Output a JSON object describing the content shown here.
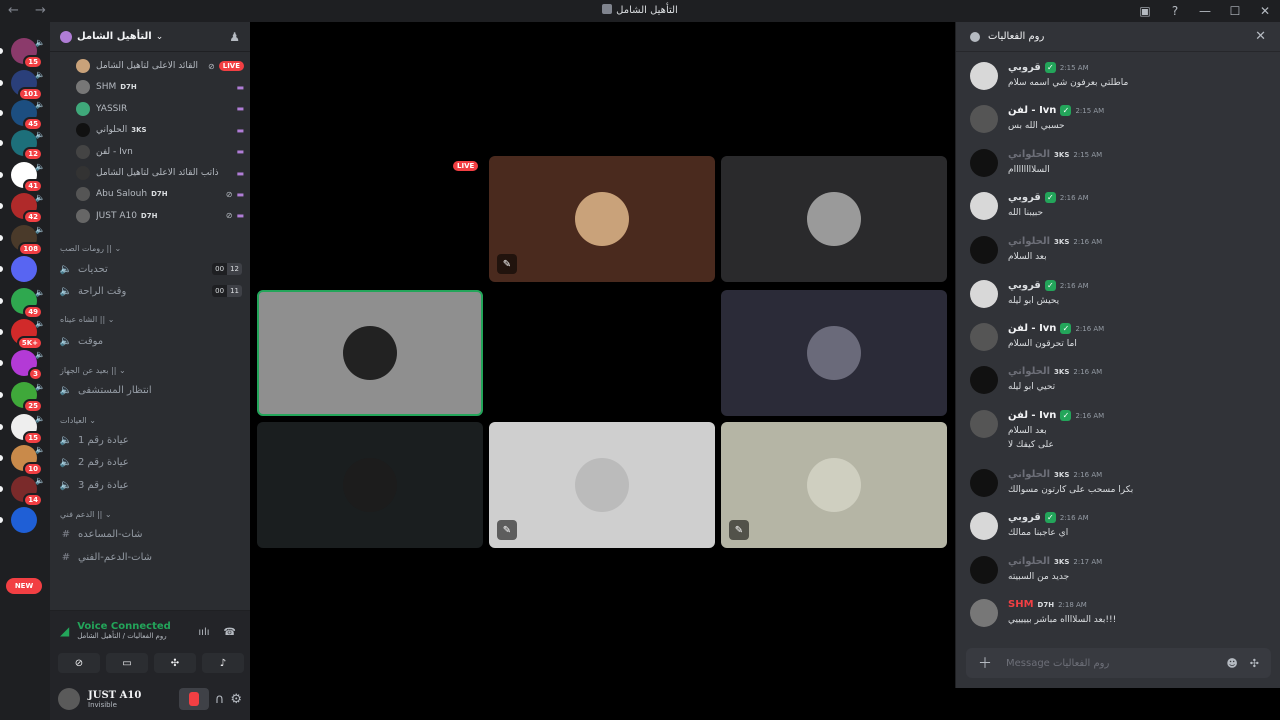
{
  "window": {
    "title": "التأهيل الشامل",
    "nav": "← →",
    "controls": [
      "▣",
      "?",
      "—",
      "☐",
      "✕"
    ]
  },
  "servers": [
    {
      "badge": "15",
      "color": "#8b3a6b"
    },
    {
      "badge": "101",
      "color": "#2a3f7a"
    },
    {
      "badge": "45",
      "color": "#1c4e80"
    },
    {
      "badge": "12",
      "color": "#1d6f7a"
    },
    {
      "badge": "41",
      "color": "#ffffff"
    },
    {
      "badge": "42",
      "color": "#b02a2a"
    },
    {
      "badge": "108",
      "color": "#4a3a2a"
    },
    {
      "badge": "",
      "color": "#5865f2"
    },
    {
      "badge": "49",
      "color": "#2fa84f"
    },
    {
      "badge": "5K+",
      "color": "#d12a2a"
    },
    {
      "badge": "3",
      "color": "#b33ad6"
    },
    {
      "badge": "25",
      "color": "#3fa83a"
    },
    {
      "badge": "15",
      "color": "#eeeeee"
    },
    {
      "badge": "10",
      "color": "#c98a4a"
    },
    {
      "badge": "14",
      "color": "#7a2a2a"
    },
    {
      "badge": "",
      "color": "#1f5fd6"
    }
  ],
  "new_badge": "NEW",
  "guild": {
    "name": "التأهيل الشامل"
  },
  "voice_users": [
    {
      "name": "القائد الاعلى لتأهيل الشامل",
      "tag": "",
      "live": "LIVE",
      "color": "#c9a27a"
    },
    {
      "name": "SHM",
      "tag": "D7H",
      "live": "",
      "color": "#777777"
    },
    {
      "name": "YASSIR",
      "tag": "",
      "live": "",
      "color": "#3fa87a"
    },
    {
      "name": "الحلواني",
      "tag": "3KS",
      "live": "",
      "color": "#111111"
    },
    {
      "name": "لفن - Ivn",
      "tag": "",
      "live": "",
      "color": "#444444"
    },
    {
      "name": "ذاتب القائد الاعلى لتأهيل الشامل",
      "tag": "",
      "live": "",
      "color": "#333333"
    },
    {
      "name": "Abu Salouh",
      "tag": "D7H",
      "live": "",
      "color": "#555555"
    },
    {
      "name": "JUST A10",
      "tag": "D7H",
      "live": "",
      "color": "#666666"
    }
  ],
  "categories": [
    {
      "label": "رومات الصب ||"
    },
    {
      "label": "الشاه عيناه ||"
    },
    {
      "label": "بعيد عن الجهاز ||"
    },
    {
      "label": "العيادات"
    },
    {
      "label": "الدعم فني ||"
    }
  ],
  "channels": [
    {
      "label": "تحديات",
      "c1": "00",
      "c2": "12"
    },
    {
      "label": "وقت الراحة",
      "c1": "00",
      "c2": "11"
    },
    {
      "label": "موقت",
      "c1": "",
      "c2": ""
    },
    {
      "label": "انتظار المستشفى",
      "c1": "",
      "c2": ""
    },
    {
      "label": "عيادة رقم 1",
      "c1": "",
      "c2": ""
    },
    {
      "label": "عيادة رقم 2",
      "c1": "",
      "c2": ""
    },
    {
      "label": "عيادة رقم 3",
      "c1": "",
      "c2": ""
    },
    {
      "label": "شات-المساعده",
      "c1": "",
      "c2": ""
    },
    {
      "label": "شات-الدعم-الفني",
      "c1": "",
      "c2": ""
    }
  ],
  "voice_connected": {
    "title": "Voice Connected",
    "subtitle": "روم الفعاليات / التأهيل الشامل"
  },
  "me": {
    "name": "JUST A10",
    "status": "Invisible"
  },
  "stage": {
    "live": "LIVE"
  },
  "tiles": [
    {
      "bg": "#4a2a1e",
      "avatar": "#c9a27a",
      "mic": "✎"
    },
    {
      "bg": "#2a2a2c",
      "avatar": "#9a9a9a",
      "mic": ""
    },
    {
      "bg": "#8f8f8f",
      "avatar": "#222222",
      "mic": ""
    },
    {
      "bg": "#000000",
      "avatar": "#000000",
      "mic": ""
    },
    {
      "bg": "#2b2b38",
      "avatar": "#6a6a7a",
      "mic": ""
    },
    {
      "bg": "#1a1e1f",
      "avatar": "#1c1c1c",
      "mic": ""
    },
    {
      "bg": "#cfcfcf",
      "avatar": "#bbbbbb",
      "mic": "✎"
    },
    {
      "bg": "#b5b5a5",
      "avatar": "#cfcfc0",
      "mic": "✎"
    }
  ],
  "chat": {
    "title": "روم الفعاليات",
    "placeholder": "Message روم الفعاليات",
    "messages": [
      {
        "author": "قروبي",
        "badge": "",
        "verified": "✓",
        "time": "2:15 AM",
        "text": "ماطلتي بعرفون شي اسمه سلام",
        "text2": "",
        "color": "#dbdee1",
        "avatar": "#d8d8d8"
      },
      {
        "author": "لفن - Ivn",
        "badge": "",
        "verified": "✓",
        "time": "2:15 AM",
        "text": "حسبي الله بس",
        "text2": "",
        "color": "#f2f3f5",
        "avatar": "#555555"
      },
      {
        "author": "الحلواني",
        "badge": "3KS",
        "verified": "",
        "time": "2:15 AM",
        "text": "السلاااااااام",
        "text2": "",
        "color": "#6d6f78",
        "avatar": "#111111"
      },
      {
        "author": "قروبي",
        "badge": "",
        "verified": "✓",
        "time": "2:16 AM",
        "text": "حبيبنا الله",
        "text2": "",
        "color": "#dbdee1",
        "avatar": "#d8d8d8"
      },
      {
        "author": "الحلواني",
        "badge": "3KS",
        "verified": "",
        "time": "2:16 AM",
        "text": "بعد السلام",
        "text2": "",
        "color": "#6d6f78",
        "avatar": "#111111"
      },
      {
        "author": "قروبي",
        "badge": "",
        "verified": "✓",
        "time": "2:16 AM",
        "text": "يحيش ابو ليله",
        "text2": "",
        "color": "#dbdee1",
        "avatar": "#d8d8d8"
      },
      {
        "author": "لفن - Ivn",
        "badge": "",
        "verified": "✓",
        "time": "2:16 AM",
        "text": "اما تحرقون السلام",
        "text2": "",
        "color": "#f2f3f5",
        "avatar": "#555555"
      },
      {
        "author": "الحلواني",
        "badge": "3KS",
        "verified": "",
        "time": "2:16 AM",
        "text": "تحيي ابو ليله",
        "text2": "",
        "color": "#6d6f78",
        "avatar": "#111111"
      },
      {
        "author": "لفن - Ivn",
        "badge": "",
        "verified": "✓",
        "time": "2:16 AM",
        "text": "بعد السلام",
        "text2": "على كيفك لا",
        "color": "#f2f3f5",
        "avatar": "#555555"
      },
      {
        "author": "الحلواني",
        "badge": "3KS",
        "verified": "",
        "time": "2:16 AM",
        "text": "بكرا مسحب على كارتون مسوالك",
        "text2": "",
        "color": "#6d6f78",
        "avatar": "#111111"
      },
      {
        "author": "قروبي",
        "badge": "",
        "verified": "✓",
        "time": "2:16 AM",
        "text": "اي عاجبنا ممالك",
        "text2": "",
        "color": "#dbdee1",
        "avatar": "#d8d8d8"
      },
      {
        "author": "الحلواني",
        "badge": "3KS",
        "verified": "",
        "time": "2:17 AM",
        "text": "جديد من السبيته",
        "text2": "",
        "color": "#6d6f78",
        "avatar": "#111111"
      },
      {
        "author": "SHM",
        "badge": "D7H",
        "verified": "",
        "time": "2:18 AM",
        "text": "بعد السلااااه مباشر بيييييي!!!",
        "text2": "",
        "color": "#f23f43",
        "avatar": "#777777"
      }
    ]
  }
}
